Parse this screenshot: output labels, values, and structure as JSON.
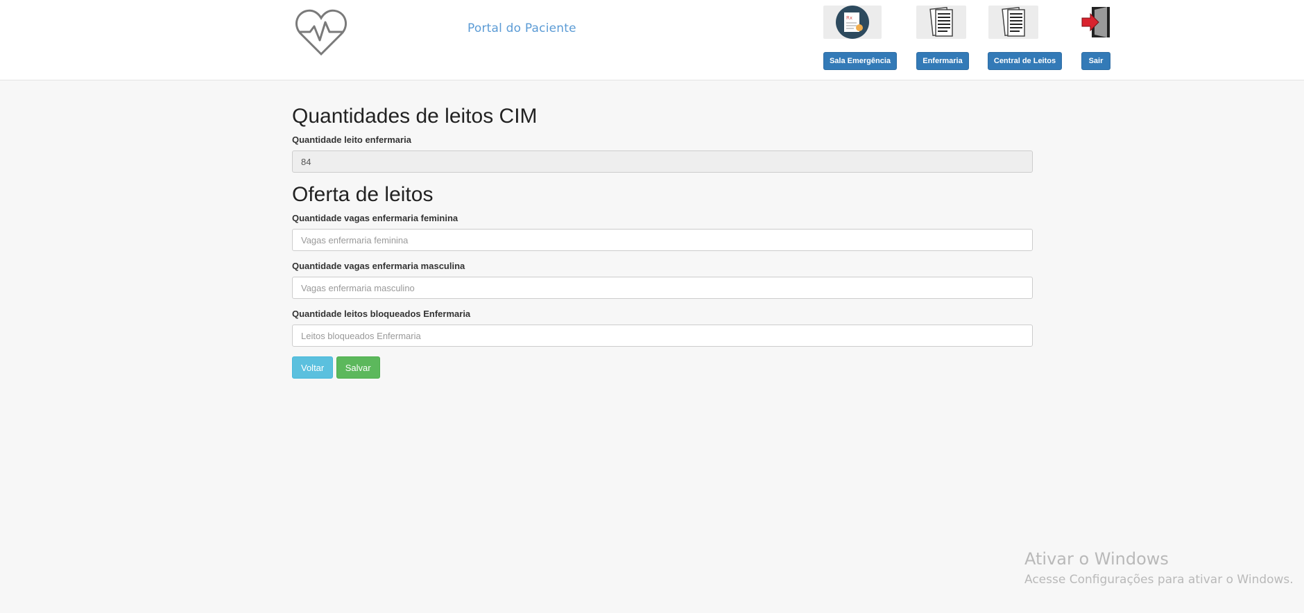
{
  "header": {
    "portal_title": "Portal do Paciente",
    "nav": [
      {
        "label": "Sala Emergência",
        "icon": "emergency-report-icon"
      },
      {
        "label": "Enfermaria",
        "icon": "documents-icon"
      },
      {
        "label": "Central de Leitos",
        "icon": "documents-icon"
      },
      {
        "label": "Sair",
        "icon": "exit-door-icon"
      }
    ]
  },
  "cim": {
    "heading": "Quantidades de leitos CIM",
    "field_label": "Quantidade leito enfermaria",
    "field_value": "84"
  },
  "oferta": {
    "heading": "Oferta de leitos",
    "feminina_label": "Quantidade vagas enfermaria feminina",
    "feminina_placeholder": "Vagas enfermaria feminina",
    "masculina_label": "Quantidade vagas enfermaria masculina",
    "masculina_placeholder": "Vagas enfermaria masculino",
    "bloqueados_label": "Quantidade leitos bloqueados Enfermaria",
    "bloqueados_placeholder": "Leitos bloqueados Enfermaria"
  },
  "actions": {
    "back_label": "Voltar",
    "save_label": "Salvar"
  },
  "watermark": {
    "line1": "Ativar o Windows",
    "line2": "Acesse Configurações para ativar o Windows."
  },
  "colors": {
    "primary": "#337ab7",
    "info": "#5bc0de",
    "success": "#5cb85c",
    "title_blue": "#5b9bd5"
  }
}
